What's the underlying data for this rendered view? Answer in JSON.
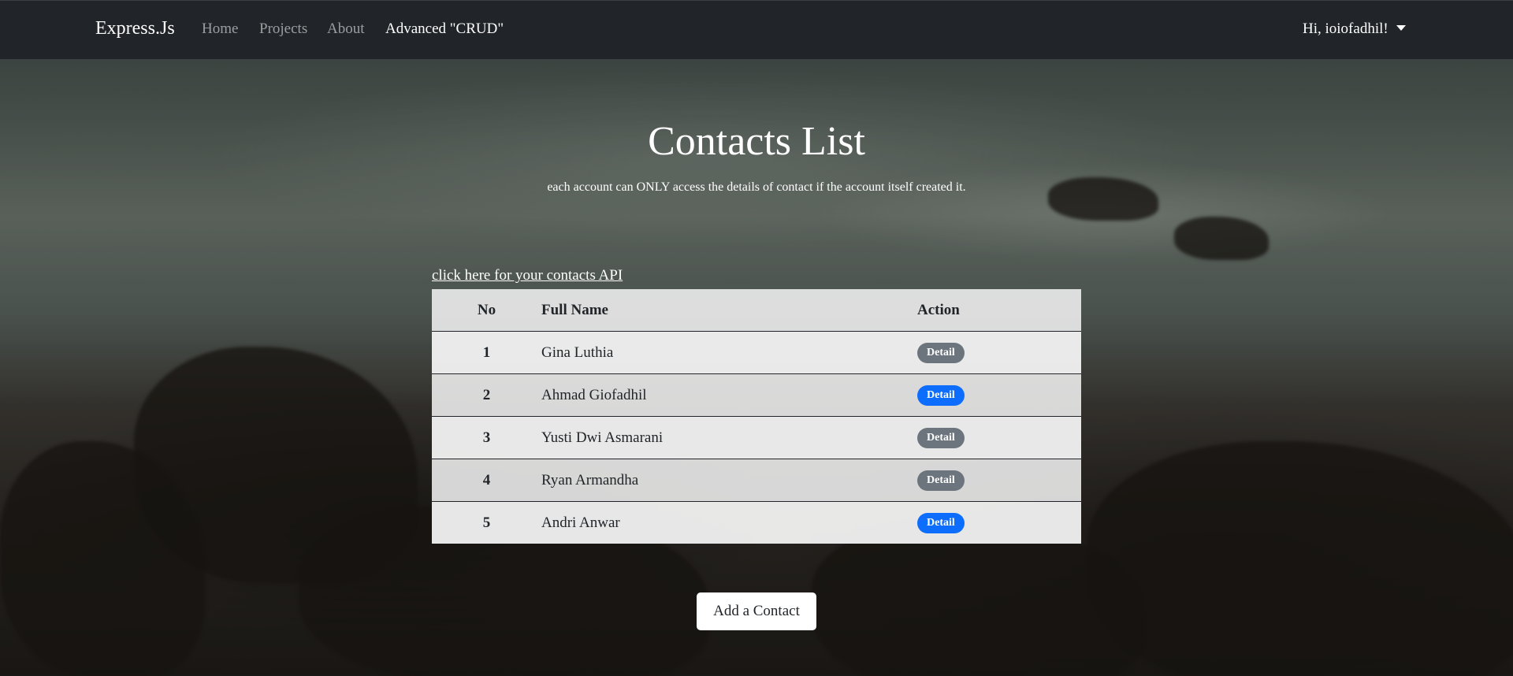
{
  "navbar": {
    "brand": "Express.Js",
    "links": [
      {
        "label": "Home"
      },
      {
        "label": "Projects"
      },
      {
        "label": "About"
      },
      {
        "label": "Advanced \"CRUD\""
      }
    ],
    "user_greeting": "Hi, ioiofadhil!"
  },
  "main": {
    "title": "Contacts List",
    "subtitle": "each account can ONLY access the details of contact if the account itself created it.",
    "api_link": "click here for your contacts API",
    "table": {
      "headers": {
        "no": "No",
        "name": "Full Name",
        "action": "Action"
      },
      "rows": [
        {
          "no": "1",
          "name": "Gina Luthia",
          "action": "Detail",
          "action_color": "#6c757d"
        },
        {
          "no": "2",
          "name": "Ahmad Giofadhil",
          "action": "Detail",
          "action_color": "#0d6efd"
        },
        {
          "no": "3",
          "name": "Yusti Dwi Asmarani",
          "action": "Detail",
          "action_color": "#6c757d"
        },
        {
          "no": "4",
          "name": "Ryan Armandha",
          "action": "Detail",
          "action_color": "#6c757d"
        },
        {
          "no": "5",
          "name": "Andri Anwar",
          "action": "Detail",
          "action_color": "#0d6efd"
        }
      ]
    },
    "add_button": "Add a Contact"
  },
  "colors": {
    "navbar_bg": "#212529",
    "primary": "#0d6efd",
    "secondary": "#6c757d"
  }
}
